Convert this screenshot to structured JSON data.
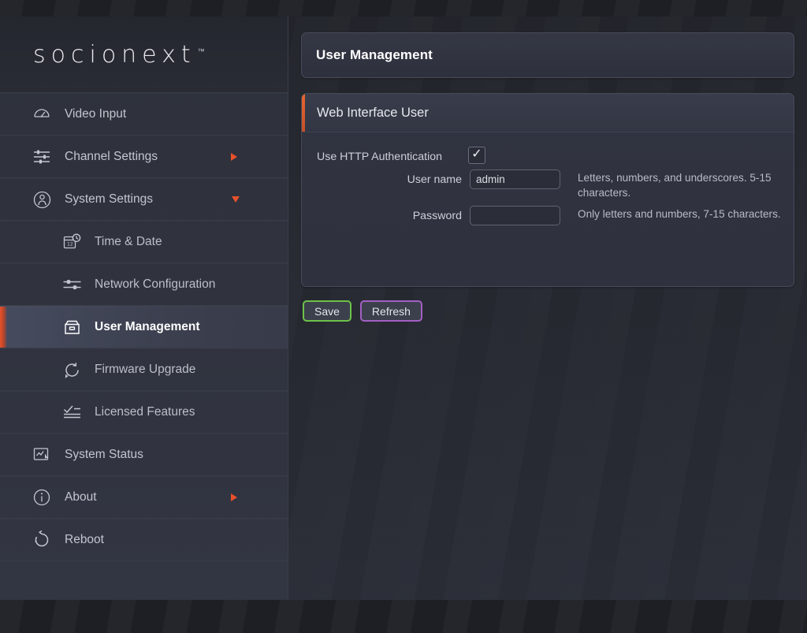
{
  "brand": {
    "name": "socionext",
    "tm": "™"
  },
  "sidebar": {
    "items": [
      {
        "label": "Video Input",
        "icon": "gauge-icon",
        "level": "top",
        "caret": "none",
        "active": false
      },
      {
        "label": "Channel Settings",
        "icon": "sliders-icon",
        "level": "top",
        "caret": "right",
        "active": false
      },
      {
        "label": "System Settings",
        "icon": "user-circle-icon",
        "level": "top",
        "caret": "down",
        "active": false
      },
      {
        "label": "Time & Date",
        "icon": "calendar-clock-icon",
        "level": "sub",
        "caret": "none",
        "active": false
      },
      {
        "label": "Network Configuration",
        "icon": "sliders-icon",
        "level": "sub",
        "caret": "none",
        "active": false
      },
      {
        "label": "User Management",
        "icon": "archive-box-icon",
        "level": "sub",
        "caret": "none",
        "active": true
      },
      {
        "label": "Firmware Upgrade",
        "icon": "refresh-circle-icon",
        "level": "sub",
        "caret": "none",
        "active": false
      },
      {
        "label": "Licensed Features",
        "icon": "checklist-icon",
        "level": "sub",
        "caret": "none",
        "active": false
      },
      {
        "label": "System Status",
        "icon": "monitor-chart-icon",
        "level": "top",
        "caret": "none",
        "active": false
      },
      {
        "label": "About",
        "icon": "info-circle-icon",
        "level": "top",
        "caret": "right",
        "active": false
      },
      {
        "label": "Reboot",
        "icon": "reboot-icon",
        "level": "top",
        "caret": "none",
        "active": false
      }
    ]
  },
  "page": {
    "title": "User Management"
  },
  "form": {
    "section_title": "Web Interface User",
    "http_auth": {
      "label": "Use HTTP Authentication",
      "checked": true,
      "check_glyph": "✓"
    },
    "username": {
      "label": "User name",
      "value": "admin",
      "placeholder": "",
      "hint": "Letters, numbers, and underscores. 5-15 characters."
    },
    "password": {
      "label": "Password",
      "value": "",
      "placeholder": "",
      "hint": "Only letters and numbers, 7-15 characters."
    }
  },
  "buttons": {
    "save": "Save",
    "refresh": "Refresh"
  },
  "colors": {
    "accent_orange": "#e8512a",
    "save_border": "#6cc24a",
    "refresh_border": "#a25fc4",
    "sidebar_bg": "#2e313b",
    "panel_bg": "#303340",
    "text_primary": "#ffffff",
    "text_secondary": "#c3c6cf"
  }
}
